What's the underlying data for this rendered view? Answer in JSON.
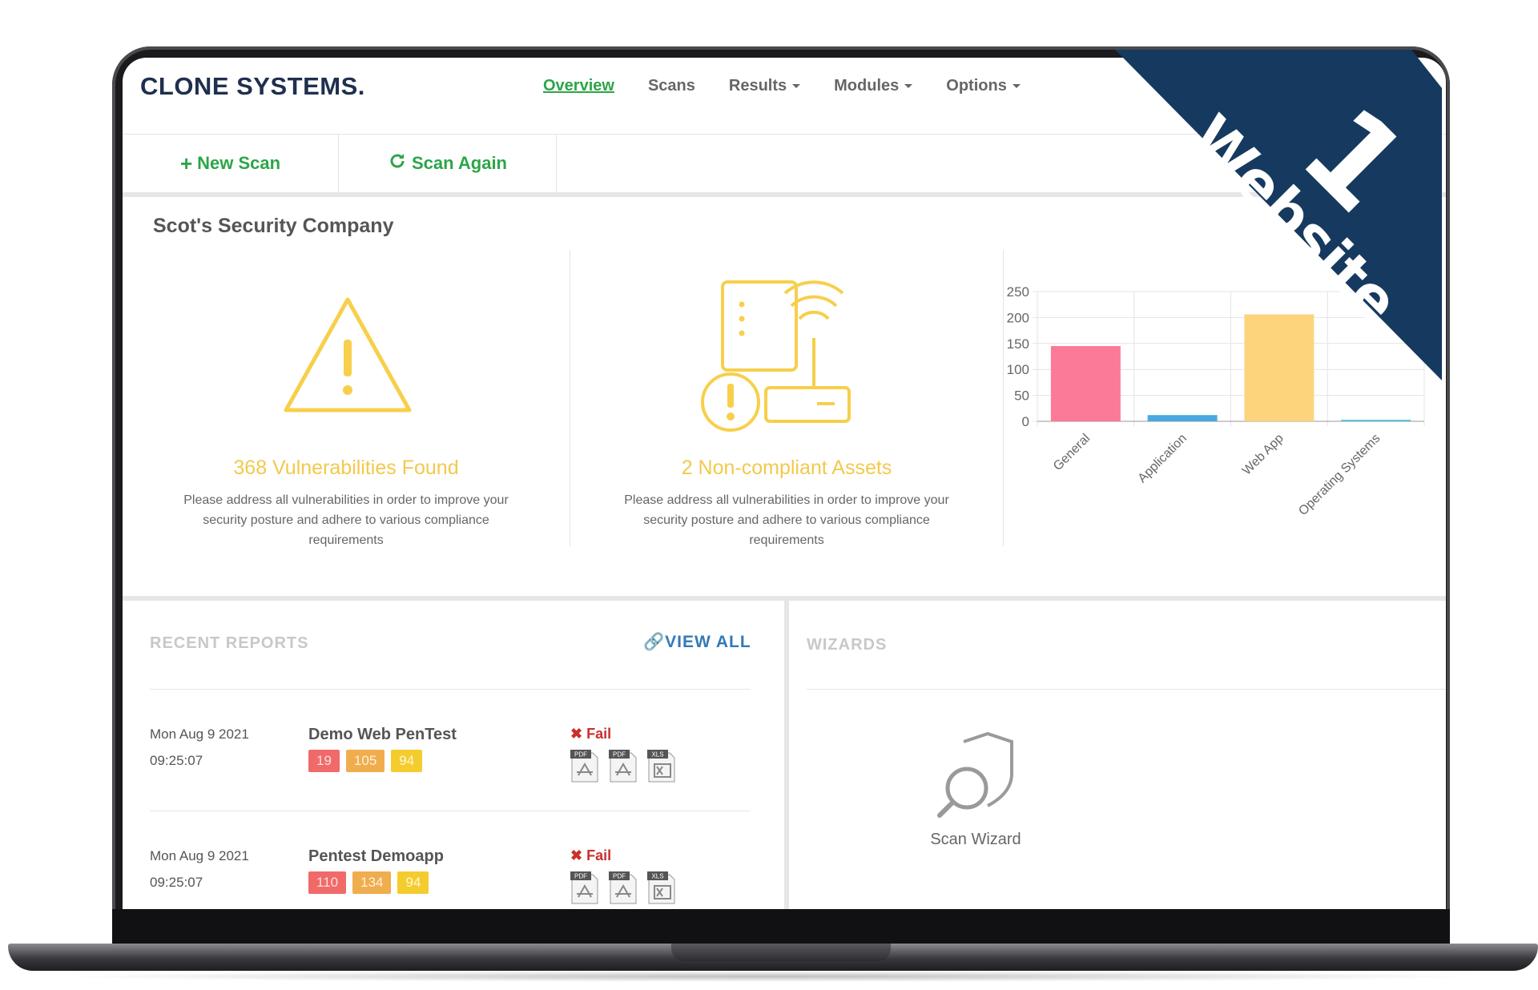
{
  "brand": {
    "name": "CLONE SYSTEMS."
  },
  "nav": {
    "overview": "Overview",
    "scans": "Scans",
    "results": "Results",
    "modules": "Modules",
    "options": "Options"
  },
  "actions": {
    "new_scan": "New Scan",
    "scan_again": "Scan Again"
  },
  "company": "Scot's Security Company",
  "summary": {
    "vulnerabilities": {
      "headline": "368 Vulnerabilities Found",
      "description": "Please address all vulnerabilities in order to improve your security posture and adhere to various compliance requirements"
    },
    "assets": {
      "headline": "2 Non-compliant Assets",
      "description": "Please address all vulnerabilities in order to improve your security posture and adhere to various compliance requirements"
    }
  },
  "chart_data": {
    "type": "bar",
    "categories": [
      "General",
      "Application",
      "Web App",
      "Operating Systems"
    ],
    "values": [
      145,
      12,
      206,
      3
    ],
    "colors": [
      "#fb7a97",
      "#4aa8e0",
      "#fdd47c",
      "#5bc0de"
    ],
    "yticks": [
      0,
      50,
      100,
      150,
      200,
      250
    ],
    "ylim": [
      0,
      250
    ],
    "grid": true
  },
  "recent_reports": {
    "title": "RECENT REPORTS",
    "view_all": "VIEW ALL",
    "items": [
      {
        "date": "Mon Aug 9 2021",
        "time": "09:25:07",
        "name": "Demo Web PenTest",
        "counts": [
          "19",
          "105",
          "94"
        ],
        "status": "Fail"
      },
      {
        "date": "Mon Aug 9 2021",
        "time": "09:25:07",
        "name": "Pentest Demoapp",
        "counts": [
          "110",
          "134",
          "94"
        ],
        "status": "Fail"
      }
    ],
    "file_labels": [
      "PDF",
      "PDF",
      "XLS"
    ]
  },
  "wizards": {
    "title": "WIZARDS",
    "scan_wizard": "Scan Wizard"
  },
  "ribbon": {
    "number": "1",
    "label": "Website",
    "color": "#163a5f"
  }
}
